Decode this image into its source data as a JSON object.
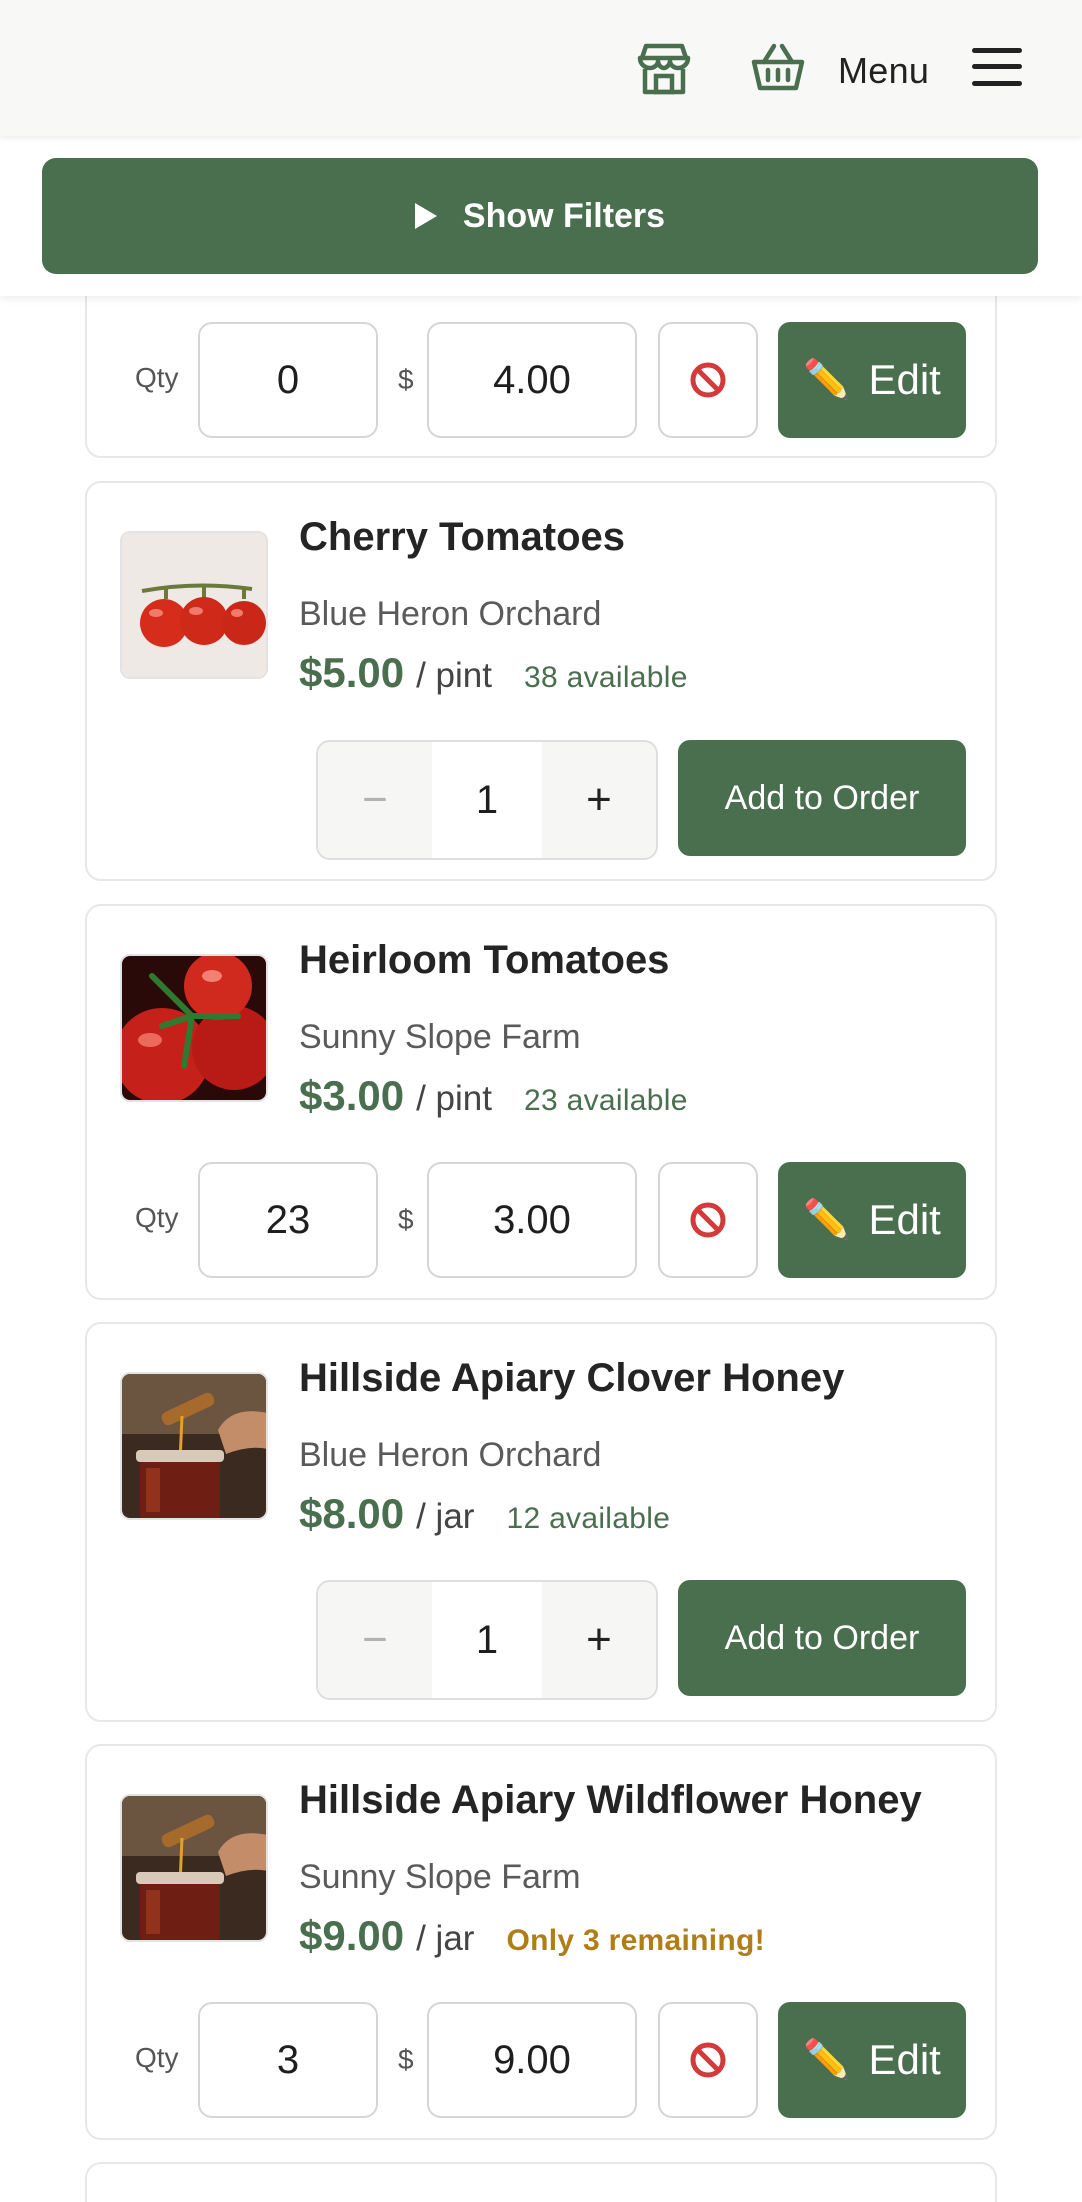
{
  "header": {
    "menu_label": "Menu",
    "icons": [
      "storefront-icon",
      "basket-icon",
      "hamburger-icon"
    ]
  },
  "filters": {
    "toggle_label": "Show Filters"
  },
  "colors": {
    "accent": "#4a6f4e",
    "low_stock": "#b07d18",
    "ban": "#d13b3b"
  },
  "labels": {
    "qty": "Qty",
    "dollar": "$",
    "edit": "Edit",
    "add_to_order": "Add to Order",
    "minus": "−",
    "plus": "+"
  },
  "products": [
    {
      "mode": "edit",
      "qty": "0",
      "amount": "4.00"
    },
    {
      "name": "Cherry Tomatoes",
      "farm": "Blue Heron Orchard",
      "price": "$5.00",
      "unit": "/ pint",
      "availability": "38 available",
      "mode": "add",
      "stepper_value": "1"
    },
    {
      "name": "Heirloom Tomatoes",
      "farm": "Sunny Slope Farm",
      "price": "$3.00",
      "unit": "/ pint",
      "availability": "23 available",
      "mode": "edit",
      "qty": "23",
      "amount": "3.00"
    },
    {
      "name": "Hillside Apiary Clover Honey",
      "farm": "Blue Heron Orchard",
      "price": "$8.00",
      "unit": "/ jar",
      "availability": "12 available",
      "mode": "add",
      "stepper_value": "1"
    },
    {
      "name": "Hillside Apiary Wildflower Honey",
      "farm": "Sunny Slope Farm",
      "price": "$9.00",
      "unit": "/ jar",
      "availability": "Only 3 remaining!",
      "low_stock": true,
      "mode": "edit",
      "qty": "3",
      "amount": "9.00"
    }
  ]
}
